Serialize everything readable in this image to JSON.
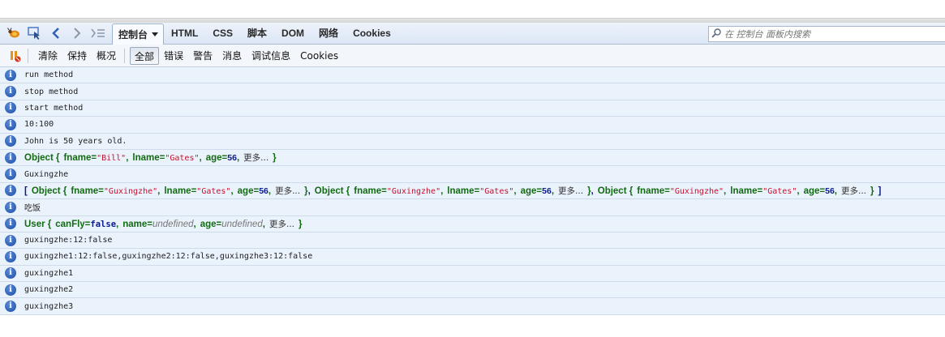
{
  "tabs": {
    "console": "控制台",
    "html": "HTML",
    "css": "CSS",
    "script": "脚本",
    "dom": "DOM",
    "net": "网络",
    "cookies": "Cookies"
  },
  "search": {
    "placeholder": "在 控制台 面板内搜索"
  },
  "toolbar": {
    "clear": "清除",
    "persist": "保持",
    "profile": "概况",
    "all": "全部",
    "errors": "错误",
    "warnings": "警告",
    "info": "消息",
    "debug": "调试信息",
    "cookies": "Cookies"
  },
  "log": {
    "l1": "run method",
    "l2": "stop method",
    "l3": "start method",
    "l4": "10:100",
    "l5": "John is 50 years old.",
    "obj1": {
      "prefix": "Object {",
      "fname": "\"Bill\"",
      "lname": "\"Gates\"",
      "age": "56",
      "more": "更多...",
      "suffix": "}"
    },
    "l7": "Guxingzhe",
    "arr": {
      "open": "[",
      "close": "]",
      "prefix": "Object {",
      "fname": "\"Guxingzhe\"",
      "lname": "\"Gates\"",
      "age": "56",
      "more": "更多...",
      "suffix": "}"
    },
    "l9": "吃饭",
    "user": {
      "prefix": "User {",
      "canFly": "false",
      "name": "undefined",
      "age": "undefined",
      "more": "更多...",
      "suffix": "}"
    },
    "l11": "guxingzhe:12:false",
    "l12": "guxingzhe1:12:false,guxingzhe2:12:false,guxingzhe3:12:false",
    "l13": "guxingzhe1",
    "l14": "guxingzhe2",
    "l15": "guxingzhe3"
  },
  "labels": {
    "fname": "fname=",
    "lname": "lname=",
    "age": "age=",
    "canFly": "canFly=",
    "name": "name=",
    "comma": ","
  },
  "colors": {
    "object": "#126b12",
    "string": "#c8102e",
    "number": "#0b1a8a",
    "row_bg": "#eaf2fb",
    "info_icon": "#1b4fa8"
  }
}
